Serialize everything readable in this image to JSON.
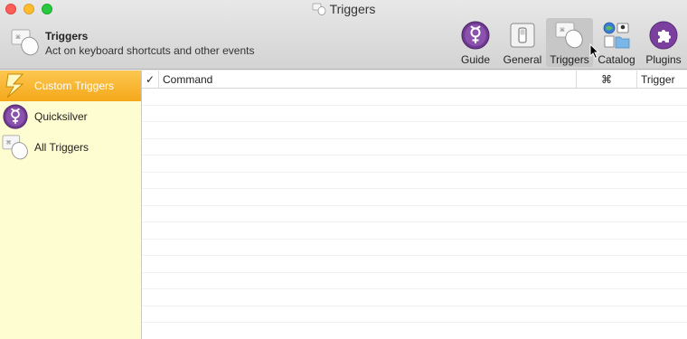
{
  "window": {
    "title": "Triggers"
  },
  "header": {
    "title": "Triggers",
    "subtitle": "Act on keyboard shortcuts and other events"
  },
  "toolbar": {
    "items": [
      {
        "label": "Guide",
        "icon": "quicksilver-icon"
      },
      {
        "label": "General",
        "icon": "switch-icon"
      },
      {
        "label": "Triggers",
        "icon": "trigger-mouse-icon",
        "active": true
      },
      {
        "label": "Catalog",
        "icon": "catalog-icon"
      },
      {
        "label": "Plugins",
        "icon": "puzzle-icon"
      }
    ]
  },
  "sidebar": {
    "items": [
      {
        "label": "Custom Triggers",
        "icon": "lightning-icon",
        "selected": true
      },
      {
        "label": "Quicksilver",
        "icon": "quicksilver-icon"
      },
      {
        "label": "All Triggers",
        "icon": "trigger-mouse-icon"
      }
    ]
  },
  "table": {
    "columns": {
      "check": "✓",
      "command": "Command",
      "shortcut": "⌘",
      "trigger": "Trigger"
    },
    "rows": []
  },
  "colors": {
    "selected_gradient_top": "#fcc751",
    "selected_gradient_bottom": "#f5a81a",
    "sidebar_bg": "#fefcd1",
    "accent_purple": "#7b3fa0"
  }
}
